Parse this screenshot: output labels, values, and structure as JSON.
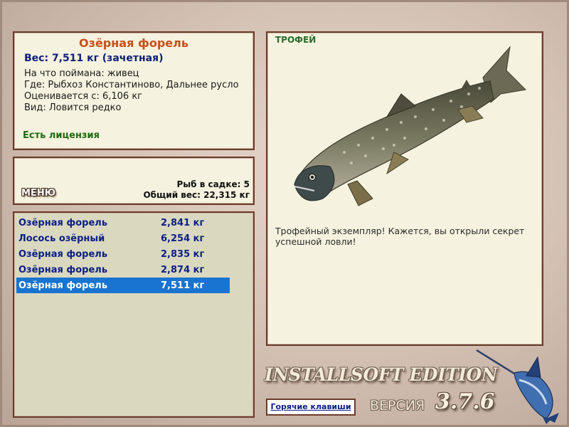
{
  "fish_info": {
    "name": "Озёрная форель",
    "weight": "Вес: 7,511 кг (зачетная)",
    "caught_on": "На что поймана: живец",
    "where": "Где: Рыбхоз Константиново, Дальнее русло",
    "rated_from": "Оценивается с: 6,106 кг",
    "kind": "Вид: Ловится редко",
    "license": "Есть лицензия"
  },
  "menu": {
    "label": "МЕНЮ",
    "fish_in_keep": "Рыб в садке: 5",
    "total_weight": "Общий вес: 22,315 кг"
  },
  "catch_list": [
    {
      "name": "Озёрная форель",
      "weight": "2,841 кг"
    },
    {
      "name": "Лосось озёрный",
      "weight": "6,254 кг"
    },
    {
      "name": "Озёрная форель",
      "weight": "2,835 кг"
    },
    {
      "name": "Озёрная форель",
      "weight": "2,874 кг"
    },
    {
      "name": "Озёрная форель",
      "weight": "7,511 кг"
    }
  ],
  "selected_index": 4,
  "trophy": {
    "title": "ТРОФЕЙ",
    "message": "Трофейный экземпляр! Кажется, вы открыли секрет успешной ловли!"
  },
  "footer": {
    "edition": "INSTALLSOFT EDITION",
    "hotkeys": "Горячие клавиши",
    "version_label": "ВЕРСИЯ",
    "version_number": "3.7.6"
  },
  "colors": {
    "fish_name": "#c8501a",
    "weight_text": "#0f1f7a",
    "license_text": "#1d6b12",
    "selection": "#1874d0",
    "panel_border": "#6b3a2a"
  },
  "icons": {
    "trophy_fish": "lake-trout-image",
    "logo": "marlin-logo"
  }
}
